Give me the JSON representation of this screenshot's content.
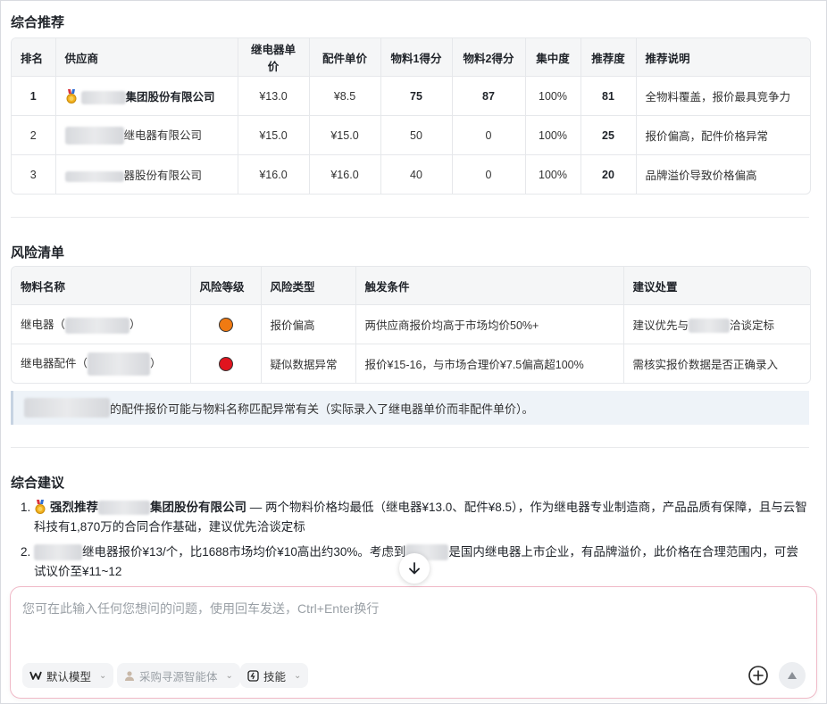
{
  "recommend": {
    "title": "综合推荐",
    "headers": [
      "排名",
      "供应商",
      "继电器单价",
      "配件单价",
      "物料1得分",
      "物料2得分",
      "集中度",
      "推荐度",
      "推荐说明"
    ],
    "rows": [
      {
        "rank": "1",
        "supplier_suffix": "集团股份有限公司",
        "relay_price": "¥13.0",
        "part_price": "¥8.5",
        "score1": "75",
        "score2": "87",
        "concentration": "100%",
        "recommend": "81",
        "note": "全物料覆盖，报价最具竞争力"
      },
      {
        "rank": "2",
        "supplier_suffix": "继电器有限公司",
        "relay_price": "¥15.0",
        "part_price": "¥15.0",
        "score1": "50",
        "score2": "0",
        "concentration": "100%",
        "recommend": "25",
        "note": "报价偏高，配件价格异常"
      },
      {
        "rank": "3",
        "supplier_suffix": "器股份有限公司",
        "relay_price": "¥16.0",
        "part_price": "¥16.0",
        "score1": "40",
        "score2": "0",
        "concentration": "100%",
        "recommend": "20",
        "note": "品牌溢价导致价格偏高"
      }
    ]
  },
  "risk": {
    "title": "风险清单",
    "headers": [
      "物料名称",
      "风险等级",
      "风险类型",
      "触发条件",
      "建议处置"
    ],
    "rows": [
      {
        "name_prefix": "继电器（",
        "name_suffix": "）",
        "level_color": "#f07a12",
        "type": "报价偏高",
        "trigger": "两供应商报价均高于市场均价50%+",
        "action_prefix": "建议优先与",
        "action_suffix": "洽谈定标"
      },
      {
        "name_prefix": "继电器配件（",
        "name_suffix": "）",
        "level_color": "#e0141e",
        "type": "疑似数据异常",
        "trigger": "报价¥15-16，与市场合理价¥7.5偏高超100%",
        "action_prefix": "需核实报价数据是否正确录入",
        "action_suffix": ""
      }
    ],
    "note_suffix": "的配件报价可能与物料名称匹配异常有关（实际录入了继电器单价而非配件单价）。"
  },
  "advice": {
    "title": "综合建议",
    "item1_lead": "强烈推荐",
    "item1_company_suffix": "集团股份有限公司",
    "item1_text": " — 两个物料价格均最低（继电器¥13.0、配件¥8.5），作为继电器专业制造商，产品品质有保障，且与云智科技有1,870万的合同合作基础，建议优先洽谈定标",
    "item2_a": "继电器报价¥13/个，比1688市场均价¥10高出约30%。考虑到",
    "item2_b": "是国内继电器上市企业，有品牌溢价，此价格在合理范围内，可尝试议价至¥11~12"
  },
  "composer": {
    "placeholder": "您可在此输入任何您想问的问题，使用回车发送，Ctrl+Enter换行",
    "model_label": "默认模型",
    "agent_label": "采购寻源智能体",
    "skill_label": "技能"
  }
}
